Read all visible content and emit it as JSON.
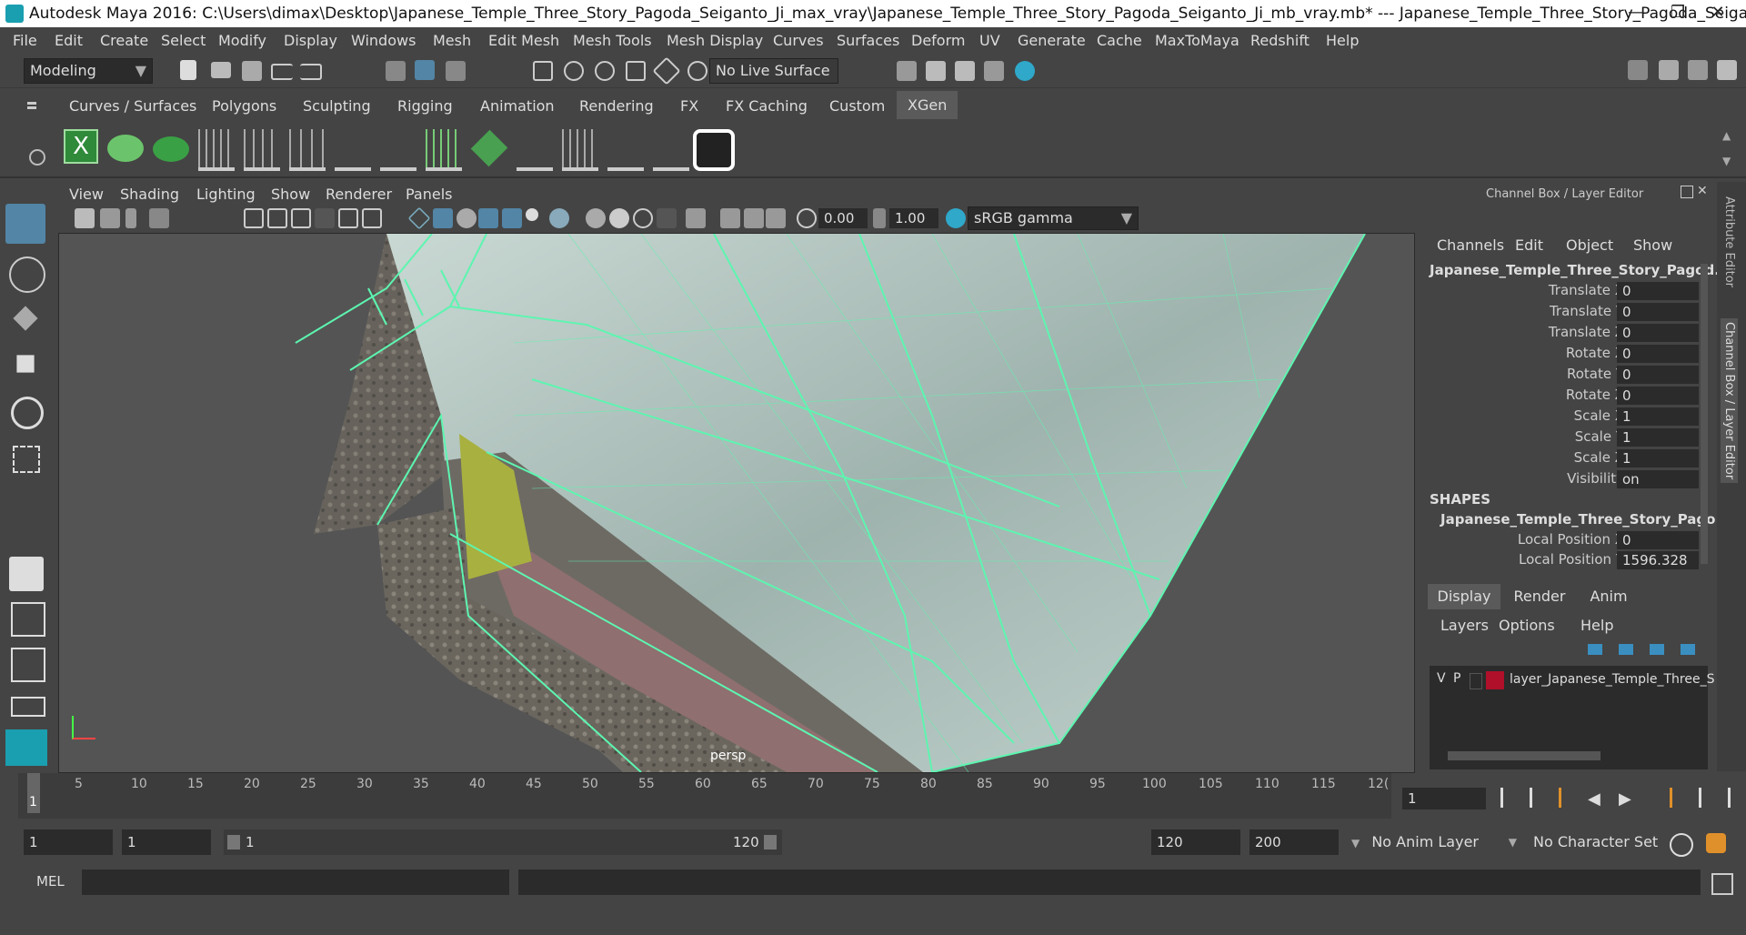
{
  "window": {
    "title": "Autodesk Maya 2016: C:\\Users\\dimax\\Desktop\\Japanese_Temple_Three_Story_Pagoda_Seiganto_Ji_max_vray\\Japanese_Temple_Three_Story_Pagoda_Seiganto_Ji_mb_vray.mb*   ---   Japanese_Temple_Three_Story_Pagoda_Seiganto_...",
    "min": "—",
    "max": "❐",
    "close": "✕"
  },
  "menu": [
    "File",
    "Edit",
    "Create",
    "Select",
    "Modify",
    "Display",
    "Windows",
    "Mesh",
    "Edit Mesh",
    "Mesh Tools",
    "Mesh Display",
    "Curves",
    "Surfaces",
    "Deform",
    "UV",
    "Generate",
    "Cache",
    "MaxToMaya",
    "Redshift",
    "Help"
  ],
  "toolbar": {
    "mode": "Modeling",
    "live_surface": "No Live Surface"
  },
  "shelf_tabs": [
    "Curves / Surfaces",
    "Polygons",
    "Sculpting",
    "Rigging",
    "Animation",
    "Rendering",
    "FX",
    "FX Caching",
    "Custom",
    "XGen"
  ],
  "shelf_active": "XGen",
  "viewport_menu": [
    "View",
    "Shading",
    "Lighting",
    "Show",
    "Renderer",
    "Panels"
  ],
  "viewport_tools": {
    "exposure": "0.00",
    "gamma": "1.00",
    "colorspace": "sRGB gamma"
  },
  "viewport_label": "persp",
  "channel_box": {
    "header": "Channel Box / Layer Editor",
    "menu": [
      "Channels",
      "Edit",
      "Object",
      "Show"
    ],
    "object": "Japanese_Temple_Three_Story_Pagod...",
    "attrs": [
      {
        "label": "Translate X",
        "value": "0"
      },
      {
        "label": "Translate Y",
        "value": "0"
      },
      {
        "label": "Translate Z",
        "value": "0"
      },
      {
        "label": "Rotate X",
        "value": "0"
      },
      {
        "label": "Rotate Y",
        "value": "0"
      },
      {
        "label": "Rotate Z",
        "value": "0"
      },
      {
        "label": "Scale X",
        "value": "1"
      },
      {
        "label": "Scale Y",
        "value": "1"
      },
      {
        "label": "Scale Z",
        "value": "1"
      },
      {
        "label": "Visibility",
        "value": "on"
      }
    ],
    "shapes_title": "SHAPES",
    "shape_name": "Japanese_Temple_Three_Story_Pago...",
    "shape_attrs": [
      {
        "label": "Local Position X",
        "value": "0"
      },
      {
        "label": "Local Position Y",
        "value": "1596.328"
      }
    ]
  },
  "layer_editor": {
    "tabs": [
      "Display",
      "Render",
      "Anim"
    ],
    "menu": [
      "Layers",
      "Options",
      "Help"
    ],
    "layer": {
      "v": "V",
      "p": "P",
      "name": "layer_Japanese_Temple_Three_S",
      "color": "#b0102a"
    }
  },
  "side_tabs": [
    "Attribute Editor",
    "Channel Box / Layer Editor"
  ],
  "timeline": {
    "ticks": [
      "5",
      "10",
      "15",
      "20",
      "25",
      "30",
      "35",
      "40",
      "45",
      "50",
      "55",
      "60",
      "65",
      "70",
      "75",
      "80",
      "85",
      "90",
      "95",
      "100",
      "105",
      "110",
      "115",
      "12("
    ],
    "current": "1",
    "current_field": "1"
  },
  "range": {
    "start": "1",
    "start2": "1",
    "slider_start": "1",
    "slider_end": "120",
    "end": "120",
    "end2": "200",
    "anim_layer": "No Anim Layer",
    "char_set": "No Character Set"
  },
  "mel_label": "MEL",
  "colors": {
    "wire": "#5df5b0",
    "accent": "#5285a6"
  }
}
